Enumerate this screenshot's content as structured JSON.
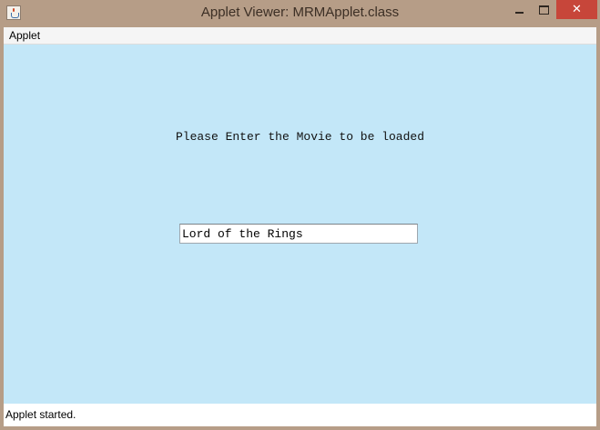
{
  "window": {
    "title": "Applet Viewer: MRMApplet.class",
    "icons": {
      "app": "java-cup-icon",
      "minimize": "minimize-icon",
      "maximize": "maximize-icon",
      "close": "close-icon"
    },
    "close_glyph": "✕",
    "colors": {
      "frame": "#b69d87",
      "close_button": "#c7463a"
    }
  },
  "menubar": {
    "items": [
      {
        "label": "Applet"
      }
    ]
  },
  "applet": {
    "background": "#c3e7f8",
    "prompt": "Please Enter the Movie to be loaded",
    "movie_input": {
      "value": "Lord of the Rings"
    }
  },
  "status": {
    "text": "Applet started."
  }
}
